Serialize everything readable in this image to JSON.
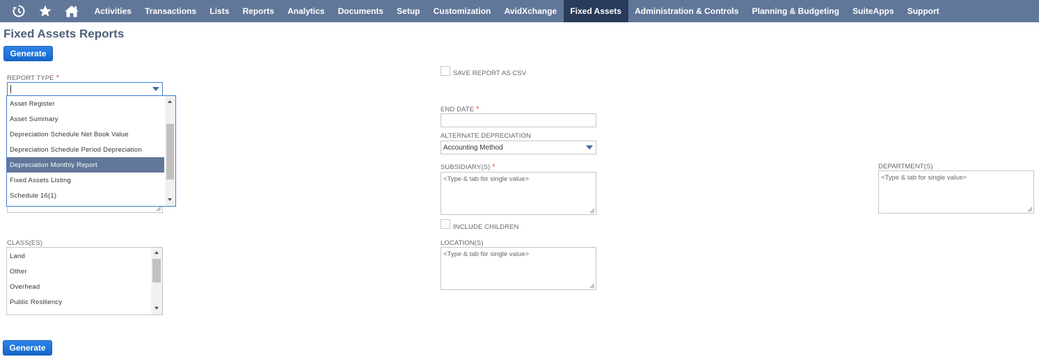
{
  "nav": {
    "icons": [
      "recent-records-icon",
      "favorites-star-icon",
      "home-icon"
    ],
    "items": [
      {
        "label": "Activities",
        "active": false
      },
      {
        "label": "Transactions",
        "active": false
      },
      {
        "label": "Lists",
        "active": false
      },
      {
        "label": "Reports",
        "active": false
      },
      {
        "label": "Analytics",
        "active": false
      },
      {
        "label": "Documents",
        "active": false
      },
      {
        "label": "Setup",
        "active": false
      },
      {
        "label": "Customization",
        "active": false
      },
      {
        "label": "AvidXchange",
        "active": false
      },
      {
        "label": "Fixed Assets",
        "active": true
      },
      {
        "label": "Administration & Controls",
        "active": false
      },
      {
        "label": "Planning & Budgeting",
        "active": false
      },
      {
        "label": "SuiteApps",
        "active": false
      },
      {
        "label": "Support",
        "active": false
      }
    ]
  },
  "page": {
    "title": "Fixed Assets Reports",
    "generate_top": "Generate",
    "generate_bottom": "Generate"
  },
  "form": {
    "report_type": {
      "label": "REPORT TYPE",
      "required": "*",
      "value": "",
      "options": [
        {
          "label": "Asset Register",
          "selected": false
        },
        {
          "label": "Asset Summary",
          "selected": false
        },
        {
          "label": "Depreciation Schedule Net Book Value",
          "selected": false
        },
        {
          "label": "Depreciation Schedule Period Depreciation",
          "selected": false
        },
        {
          "label": "Depreciation Monthly Report",
          "selected": true
        },
        {
          "label": "Fixed Assets Listing",
          "selected": false
        },
        {
          "label": "Schedule 16(1)",
          "selected": false
        }
      ]
    },
    "save_csv": {
      "label": "SAVE REPORT AS CSV",
      "checked": false
    },
    "end_date": {
      "label": "END DATE",
      "required": "*",
      "value": ""
    },
    "alternate_depreciation": {
      "label": "ALTERNATE DEPRECIATION",
      "value": "Accounting Method"
    },
    "subsidiaries": {
      "label": "SUBSIDIARY(S)",
      "required": "*",
      "placeholder": "<Type & tab for single value>"
    },
    "include_children": {
      "label": "INCLUDE CHILDREN",
      "checked": false
    },
    "locations": {
      "label": "LOCATION(S)",
      "placeholder": "<Type & tab for single value>"
    },
    "departments": {
      "label": "DEPARTMENT(S)",
      "placeholder": "<Type & tab for single value>"
    },
    "classes": {
      "label": "CLASS(ES)",
      "options": [
        "Land",
        "Other",
        "Overhead",
        "Public Resiliency"
      ]
    }
  },
  "colors": {
    "nav_bg": "#607799",
    "nav_active": "#2a3c5a",
    "button": "#1f74dc",
    "required": "#e0522a",
    "selected_row": "#607799"
  }
}
